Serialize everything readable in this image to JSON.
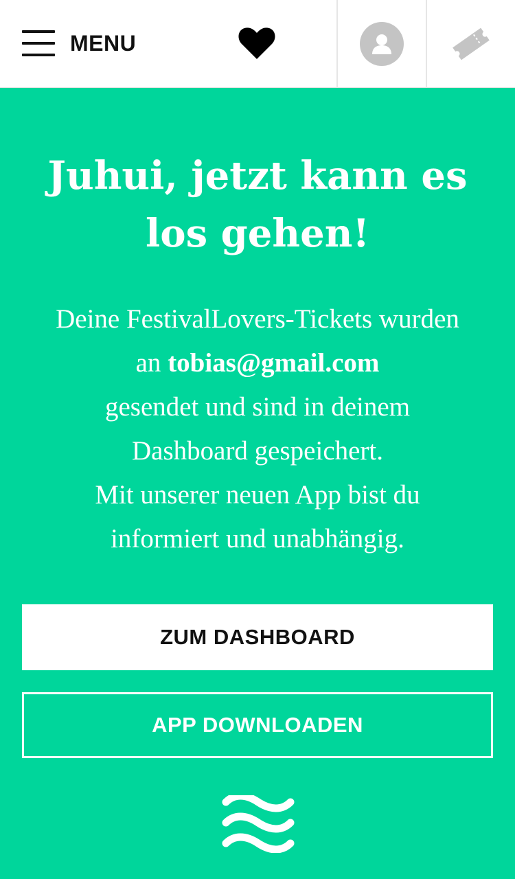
{
  "header": {
    "menu_label": "MENU",
    "icons": {
      "menu": "hamburger-icon",
      "favorites": "heart-icon",
      "account": "user-avatar-icon",
      "tickets": "ticket-icon"
    }
  },
  "main": {
    "headline_line1": "Juhui, jetzt kann es",
    "headline_line2": "los gehen!",
    "message": {
      "line1": "Deine FestivalLovers-Tickets wurden",
      "line2_prefix": "an ",
      "email": "tobias@gmail.com",
      "line3": "gesendet und sind in deinem",
      "line4": "Dashboard gespeichert.",
      "line5": "Mit unserer neuen App bist du",
      "line6": "informiert und unabhängig."
    },
    "dashboard_button_label": "ZUM DASHBOARD",
    "app_button_label": "APP DOWNLOADEN",
    "footer_icon": "waves-icon"
  },
  "colors": {
    "background": "#00d69b",
    "header_bg": "#ffffff",
    "text_light": "#ffffff",
    "text_dark": "#111111",
    "avatar_gray": "#c4c4c4"
  }
}
